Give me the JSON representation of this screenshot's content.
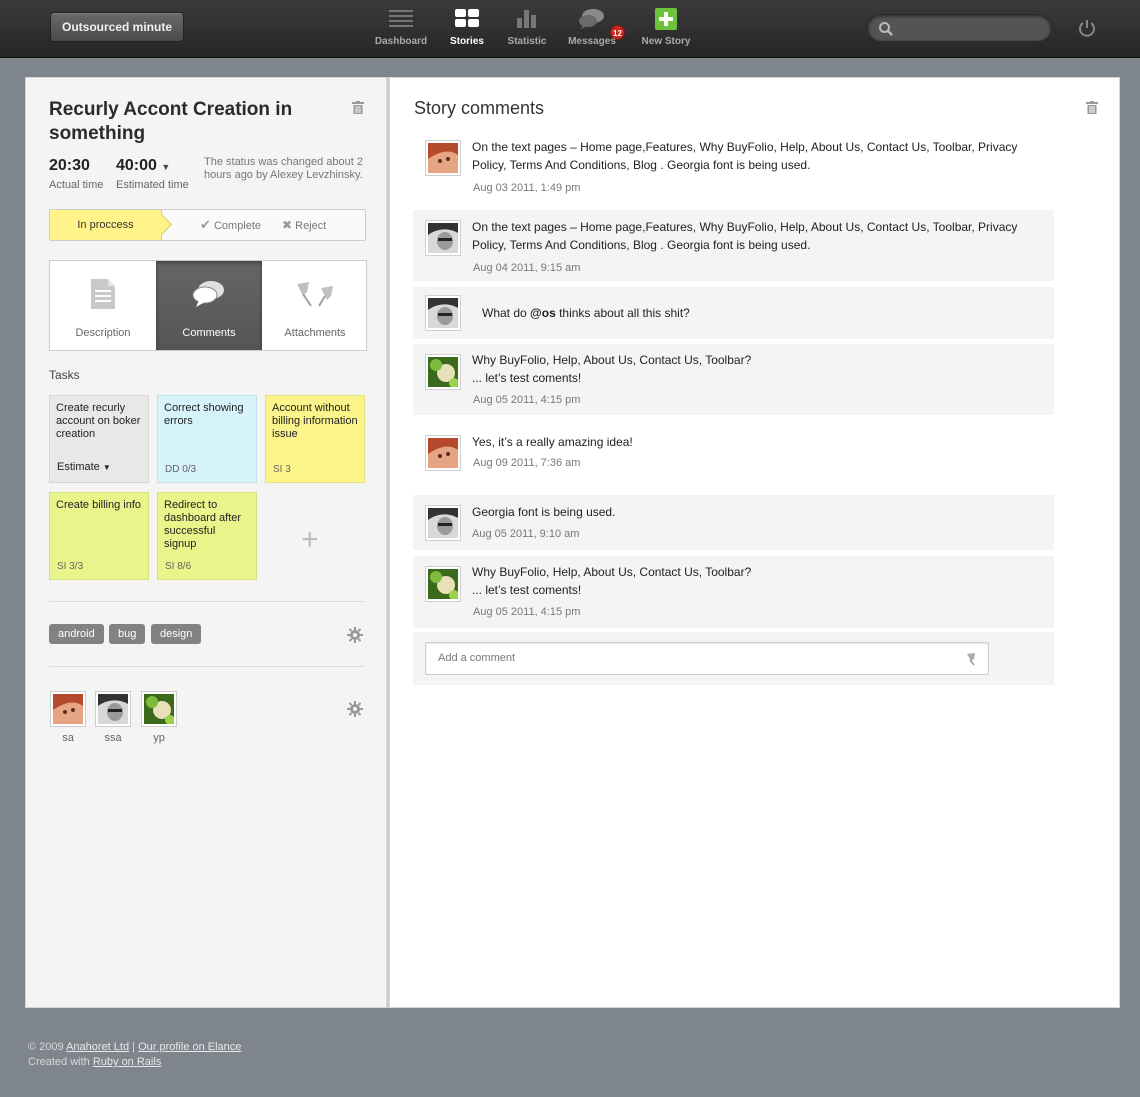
{
  "header": {
    "brand": "Outsourced minute",
    "nav": [
      {
        "label": "Dashboard",
        "icon": "dashboard-icon"
      },
      {
        "label": "Stories",
        "icon": "stories-icon",
        "active": true
      },
      {
        "label": "Statistic",
        "icon": "statistic-icon"
      },
      {
        "label": "Messages",
        "icon": "messages-icon",
        "badge": "12"
      },
      {
        "label": "New Story",
        "icon": "new-story-icon"
      }
    ],
    "search": {
      "placeholder": ""
    }
  },
  "story": {
    "title": "Recurly Accont Creation in something",
    "actual_time": "20:30",
    "actual_label": "Actual time",
    "estimated_time": "40:00",
    "estimated_label": "Estimated time",
    "status_note": "The status was changed about 2 hours ago by Alexey Levzhinsky.",
    "status": {
      "current": "In proccess",
      "complete": "Complete",
      "reject": "Reject"
    },
    "tabs": [
      {
        "label": "Description",
        "icon": "document-icon"
      },
      {
        "label": "Comments",
        "icon": "comments-icon",
        "active": true
      },
      {
        "label": "Attachments",
        "icon": "pushpin-icon"
      }
    ],
    "tasks_heading": "Tasks",
    "tasks": [
      {
        "title": "Create recurly account on boker creation",
        "meta": "Estimate",
        "color": "#e8e8e8"
      },
      {
        "title": "Correct showing errors",
        "meta": "DD 0/3",
        "color": "#d6f3fb"
      },
      {
        "title": "Account without billing information issue",
        "meta": "SI 3",
        "color": "#fbf48a"
      },
      {
        "title": "Create billing info",
        "meta": "SI 3/3",
        "color": "#e9f58a"
      },
      {
        "title": "Redirect to dashboard after successful signup",
        "meta": "SI 8/6",
        "color": "#e9f58a"
      }
    ],
    "add_task": "+",
    "tags": [
      "android",
      "bug",
      "design"
    ],
    "members": [
      {
        "name": "sa"
      },
      {
        "name": "ssa"
      },
      {
        "name": "yp"
      }
    ]
  },
  "comments_panel": {
    "title": "Story comments",
    "comments": [
      {
        "text": "On the text pages – Home page,Features, Why BuyFolio, Help, About Us, Contact Us, Toolbar, Privacy Policy, Terms And Conditions, Blog . Georgia font is being used.",
        "date": "Aug 03 2011, 1:49 pm",
        "avatar": "woman"
      },
      {
        "text": "On the text pages – Home page,Features, Why BuyFolio, Help, About Us, Contact Us, Toolbar, Privacy Policy, Terms And Conditions, Blog . Georgia font is being used.",
        "date": "Aug 04 2011, 9:15 am",
        "avatar": "man"
      },
      {
        "text_before": "What do ",
        "mention": "@os",
        "text_after": " thinks about all this shit?",
        "date": "",
        "avatar": "man"
      },
      {
        "line1": "Why BuyFolio, Help, About Us, Contact Us, Toolbar?",
        "line2": "... let’s test coments!",
        "date": "Aug 05 2011, 4:15 pm",
        "avatar": "nature"
      },
      {
        "text": "Yes, it’s a really amazing idea!",
        "date": "Aug 09 2011, 7:36 am",
        "avatar": "woman"
      },
      {
        "text": "Georgia font is being used.",
        "date": "Aug 05 2011, 9:10 am",
        "avatar": "man"
      },
      {
        "line1": "Why BuyFolio, Help, About Us, Contact Us, Toolbar?",
        "line2": "... let’s test coments!",
        "date": "Aug 05 2011, 4:15 pm",
        "avatar": "nature"
      }
    ],
    "add_comment_placeholder": "Add a comment"
  },
  "footer": {
    "copyright": "© 2009",
    "company": "Anahoret Ltd",
    "separator": "|",
    "profile_link": "Our profile on Elance",
    "created_with": "Created with",
    "rails_link": "Ruby on Rails"
  }
}
